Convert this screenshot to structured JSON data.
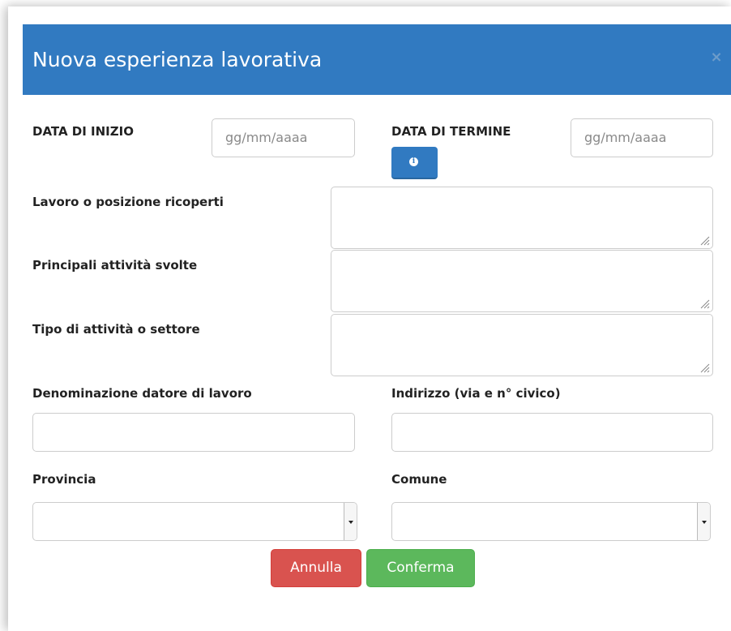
{
  "modal": {
    "title": "Nuova esperienza lavorativa",
    "close_label": "×",
    "header_color": "#317ac1"
  },
  "form": {
    "start_date": {
      "label": "DATA DI INIZIO",
      "placeholder": "gg/mm/aaaa"
    },
    "end_date": {
      "label": "DATA DI TERMINE",
      "placeholder": "gg/mm/aaaa",
      "info_icon": "info-circle-icon"
    },
    "job_position": {
      "label": "Lavoro o posizione ricoperti",
      "value": ""
    },
    "main_activities": {
      "label": "Principali attività svolte",
      "value": ""
    },
    "activity_type": {
      "label": "Tipo di attività o settore",
      "value": ""
    },
    "employer_name": {
      "label": "Denominazione datore di lavoro",
      "value": ""
    },
    "address": {
      "label": "Indirizzo (via e n° civico)",
      "value": ""
    },
    "province": {
      "label": "Provincia",
      "selected": ""
    },
    "municipality": {
      "label": "Comune",
      "selected": ""
    }
  },
  "actions": {
    "cancel_label": "Annulla",
    "confirm_label": "Conferma",
    "cancel_color": "#d9534f",
    "confirm_color": "#5cb85c"
  }
}
